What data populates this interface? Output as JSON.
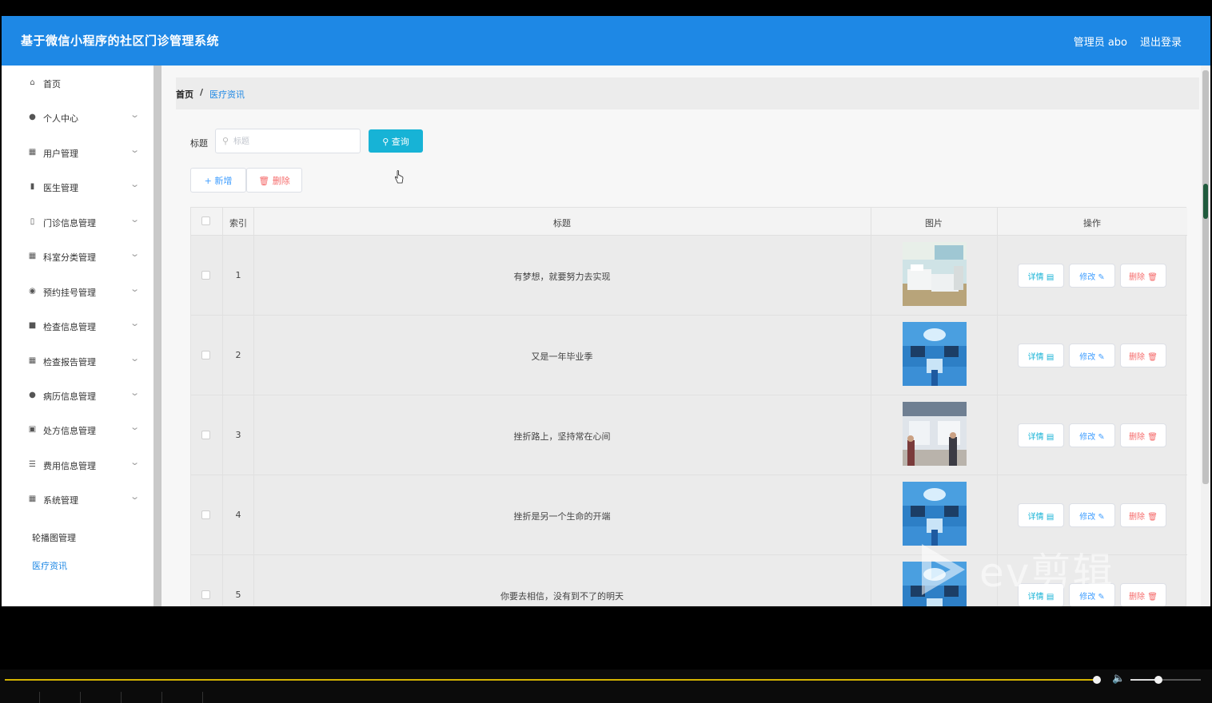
{
  "header": {
    "title": "基于微信小程序的社区门诊管理系统",
    "user": "管理员 abo",
    "logout": "退出登录",
    "color": "#1e88e5"
  },
  "sidebar": {
    "items": [
      {
        "label": "首页",
        "icon": "home-icon"
      },
      {
        "label": "个人中心",
        "icon": "person-icon"
      },
      {
        "label": "用户管理",
        "icon": "grid-icon"
      },
      {
        "label": "医生管理",
        "icon": "bar-chart-icon"
      },
      {
        "label": "门诊信息管理",
        "icon": "signal-icon"
      },
      {
        "label": "科室分类管理",
        "icon": "grid-icon"
      },
      {
        "label": "预约挂号管理",
        "icon": "pin-icon"
      },
      {
        "label": "检查信息管理",
        "icon": "box-icon"
      },
      {
        "label": "检查报告管理",
        "icon": "grid-icon"
      },
      {
        "label": "病历信息管理",
        "icon": "person-icon"
      },
      {
        "label": "处方信息管理",
        "icon": "picture-icon"
      },
      {
        "label": "费用信息管理",
        "icon": "list-icon"
      },
      {
        "label": "系统管理",
        "icon": "grid-icon"
      }
    ],
    "sub_items": [
      {
        "label": "轮播图管理",
        "active": false
      },
      {
        "label": "医疗资讯",
        "active": true
      }
    ]
  },
  "breadcrumb": {
    "home": "首页",
    "separator": "/",
    "current": "医疗资讯"
  },
  "search": {
    "label": "标题",
    "placeholder": "标题",
    "button": "查询",
    "button_color": "#17b3d6"
  },
  "actions": {
    "add": "新增",
    "delete": "删除"
  },
  "table": {
    "columns": [
      "索引",
      "标题",
      "图片",
      "操作"
    ],
    "rows": [
      {
        "index": "1",
        "title": "有梦想，就要努力去实现",
        "image": "ward-photo"
      },
      {
        "index": "2",
        "title": "又是一年毕业季",
        "image": "operating-room-photo"
      },
      {
        "index": "3",
        "title": "挫折路上，坚持常在心间",
        "image": "lobby-photo"
      },
      {
        "index": "4",
        "title": "挫折是另一个生命的开端",
        "image": "operating-room-photo"
      },
      {
        "index": "5",
        "title": "你要去相信，没有到不了的明天",
        "image": "operating-room-photo"
      }
    ],
    "row_actions": {
      "detail": "详情",
      "edit": "修改",
      "delete": "删除"
    }
  },
  "watermark": {
    "text": "ev剪辑"
  },
  "player": {
    "progress_fraction": 0.9,
    "volume_fraction": 0.4
  }
}
